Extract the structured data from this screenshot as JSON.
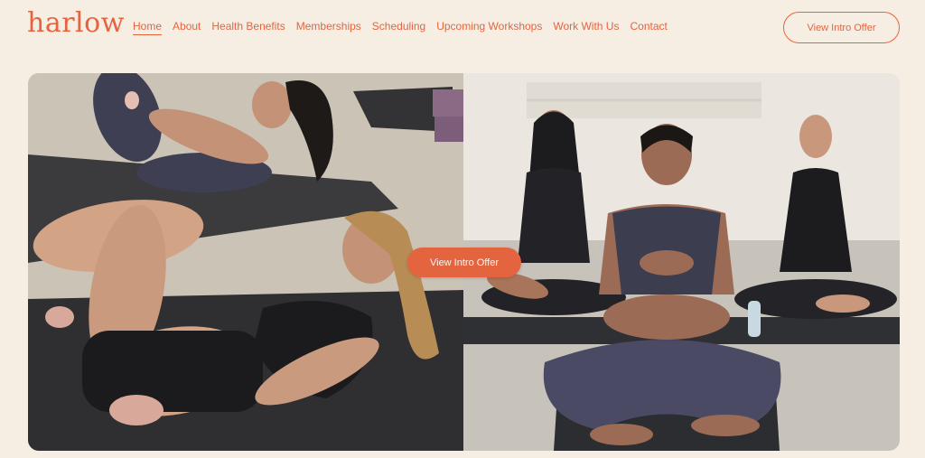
{
  "brand": {
    "logo_text": "harlow"
  },
  "nav": {
    "items": [
      {
        "label": "Home",
        "active": true
      },
      {
        "label": "About"
      },
      {
        "label": "Health Benefits"
      },
      {
        "label": "Memberships"
      },
      {
        "label": "Scheduling"
      },
      {
        "label": "Upcoming Workshops"
      },
      {
        "label": "Work With Us"
      },
      {
        "label": "Contact"
      }
    ]
  },
  "header": {
    "cta_label": "View Intro Offer"
  },
  "hero": {
    "cta_label": "View Intro Offer",
    "left_image": "pilates-class-photo",
    "right_image": "meditation-class-photo"
  },
  "colors": {
    "accent": "#e4643f",
    "background": "#f6eee3",
    "button_text": "#fff5ec"
  }
}
